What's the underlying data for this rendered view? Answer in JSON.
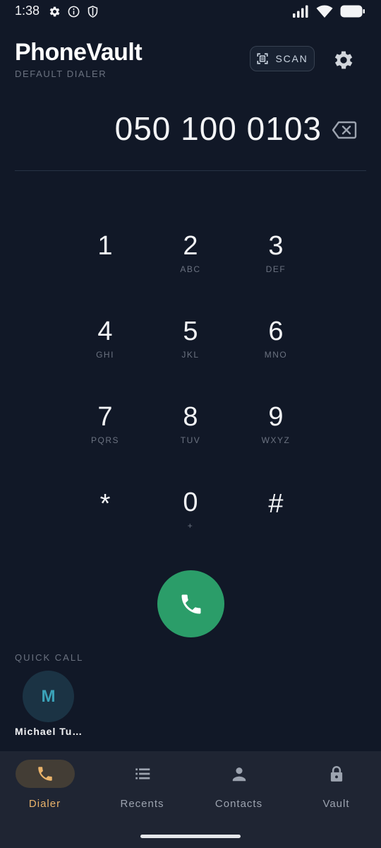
{
  "status_bar": {
    "time": "1:38",
    "icons": [
      "settings-icon",
      "info-icon",
      "shield-icon",
      "signal-icon",
      "wifi-icon",
      "battery-icon"
    ]
  },
  "header": {
    "title": "PhoneVault",
    "subtitle": "DEFAULT DIALER",
    "scan_label": "SCAN"
  },
  "dialer": {
    "number": "050 100 0103"
  },
  "keypad": [
    {
      "digit": "1",
      "letters": ""
    },
    {
      "digit": "2",
      "letters": "ABC"
    },
    {
      "digit": "3",
      "letters": "DEF"
    },
    {
      "digit": "4",
      "letters": "GHI"
    },
    {
      "digit": "5",
      "letters": "JKL"
    },
    {
      "digit": "6",
      "letters": "MNO"
    },
    {
      "digit": "7",
      "letters": "PQRS"
    },
    {
      "digit": "8",
      "letters": "TUV"
    },
    {
      "digit": "9",
      "letters": "WXYZ"
    },
    {
      "digit": "*",
      "letters": ""
    },
    {
      "digit": "0",
      "letters": "+"
    },
    {
      "digit": "#",
      "letters": ""
    }
  ],
  "quick_call": {
    "label": "QUICK CALL",
    "contacts": [
      {
        "initial": "M",
        "name": "Michael Tu…"
      }
    ]
  },
  "nav": {
    "active": "Dialer",
    "items": [
      {
        "label": "Dialer",
        "icon": "phone-icon"
      },
      {
        "label": "Recents",
        "icon": "list-icon"
      },
      {
        "label": "Contacts",
        "icon": "person-icon"
      },
      {
        "label": "Vault",
        "icon": "lock-icon"
      }
    ]
  },
  "colors": {
    "background": "#111827",
    "call_button": "#2b9d69",
    "accent": "#eab36a",
    "nav_background": "#1f2533"
  }
}
